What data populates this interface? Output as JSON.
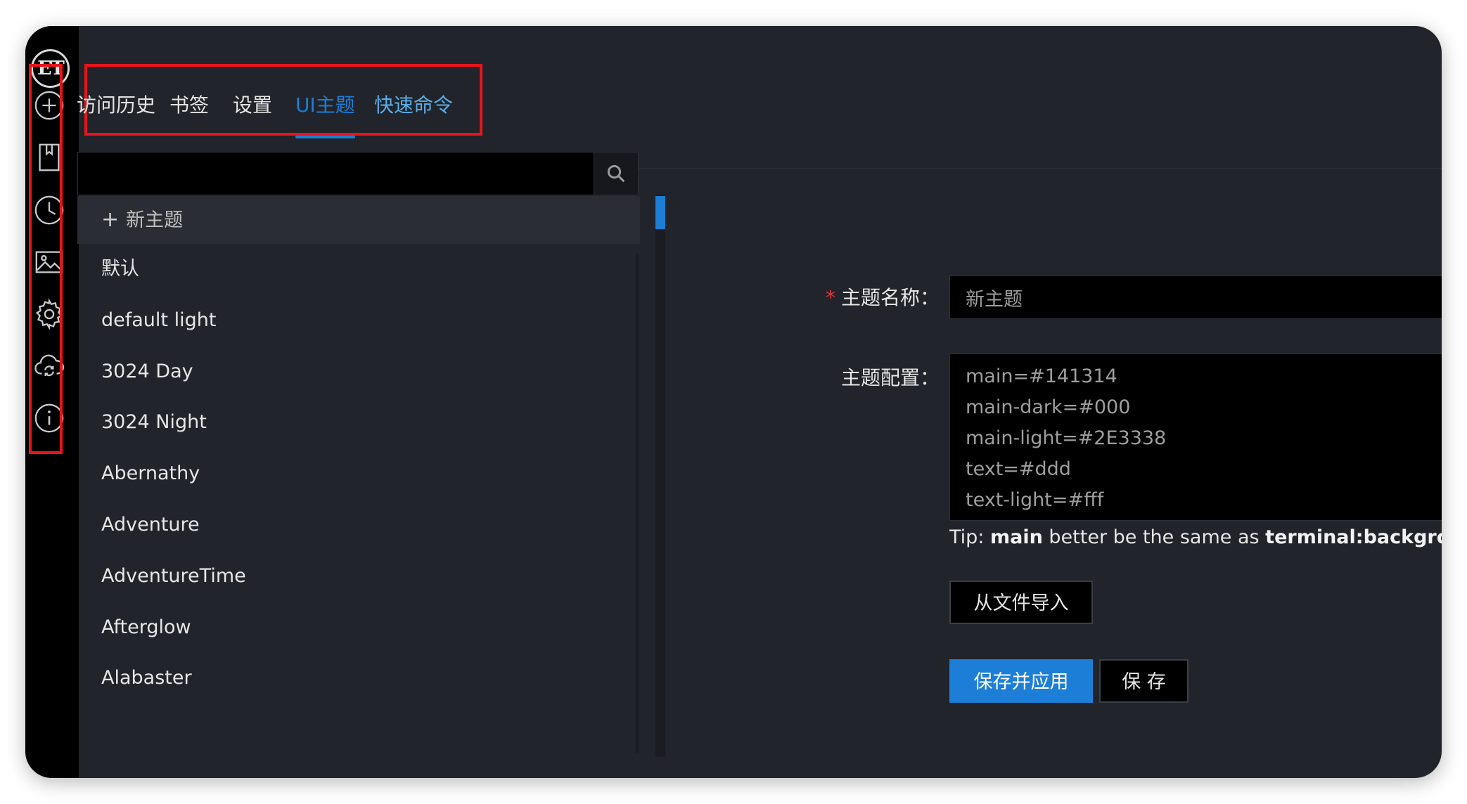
{
  "app": {
    "logo_text": "ET"
  },
  "sidebar": {
    "icons": [
      "plus-circle-icon",
      "bookmark-icon",
      "clock-icon",
      "image-icon",
      "gear-icon",
      "cloud-sync-icon",
      "info-icon"
    ]
  },
  "tabs": [
    {
      "label": "访问历史",
      "active": false
    },
    {
      "label": "书签",
      "active": false
    },
    {
      "label": "设置",
      "active": false
    },
    {
      "label": "UI主题",
      "active": true
    },
    {
      "label": "快速命令",
      "active": false
    }
  ],
  "search": {
    "value": ""
  },
  "theme_list": {
    "new_label": "新主题",
    "items": [
      "默认",
      "default light",
      "3024 Day",
      "3024 Night",
      "Abernathy",
      "Adventure",
      "AdventureTime",
      "Afterglow",
      "Alabaster"
    ]
  },
  "form": {
    "name_label": "主题名称：",
    "name_value": "新主题",
    "config_label": "主题配置：",
    "config_lines": [
      "main=#141314",
      "main-dark=#000",
      "main-light=#2E3338",
      "text=#ddd",
      "text-light=#fff"
    ],
    "tip_prefix": "Tip: ",
    "tip_key1": "main",
    "tip_middle": " better be the same as ",
    "tip_key2": "terminal:background"
  },
  "buttons": {
    "import": "从文件导入",
    "save_apply": "保存并应用",
    "save": "保 存"
  },
  "colors": {
    "accent": "#1c7ed6",
    "background": "#21242a",
    "sidebar": "#000000",
    "highlight_box": "#e8141b",
    "required": "#e8303a"
  }
}
